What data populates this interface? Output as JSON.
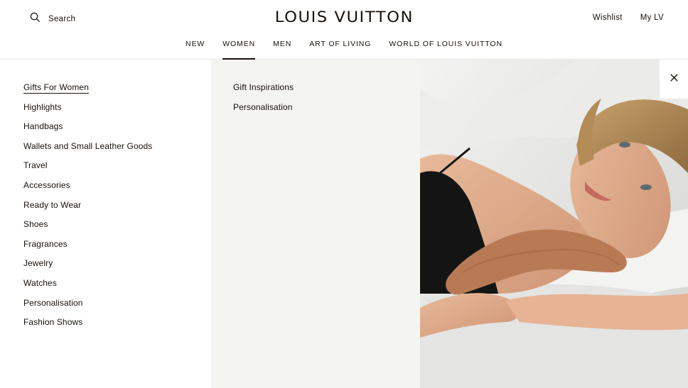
{
  "header": {
    "search_label": "Search",
    "logo": "LOUIS VUITTON",
    "wishlist": "Wishlist",
    "account": "My LV"
  },
  "nav": {
    "items": [
      "NEW",
      "WOMEN",
      "MEN",
      "ART OF LIVING",
      "WORLD OF LOUIS VUITTON"
    ],
    "active": "WOMEN"
  },
  "menu": {
    "categories": [
      "Gifts For Women",
      "Highlights",
      "Handbags",
      "Wallets and Small Leather Goods",
      "Travel",
      "Accessories",
      "Ready to Wear",
      "Shoes",
      "Fragrances",
      "Jewelry",
      "Watches",
      "Personalisation",
      "Fashion Shows"
    ],
    "active_category": "Gifts For Women",
    "subcategories": [
      "Gift Inspirations",
      "Personalisation"
    ]
  },
  "icons": {
    "search": "search-icon",
    "close": "close-icon"
  },
  "colors": {
    "text": "#19110b",
    "panel_bg": "#f4f4f1"
  }
}
